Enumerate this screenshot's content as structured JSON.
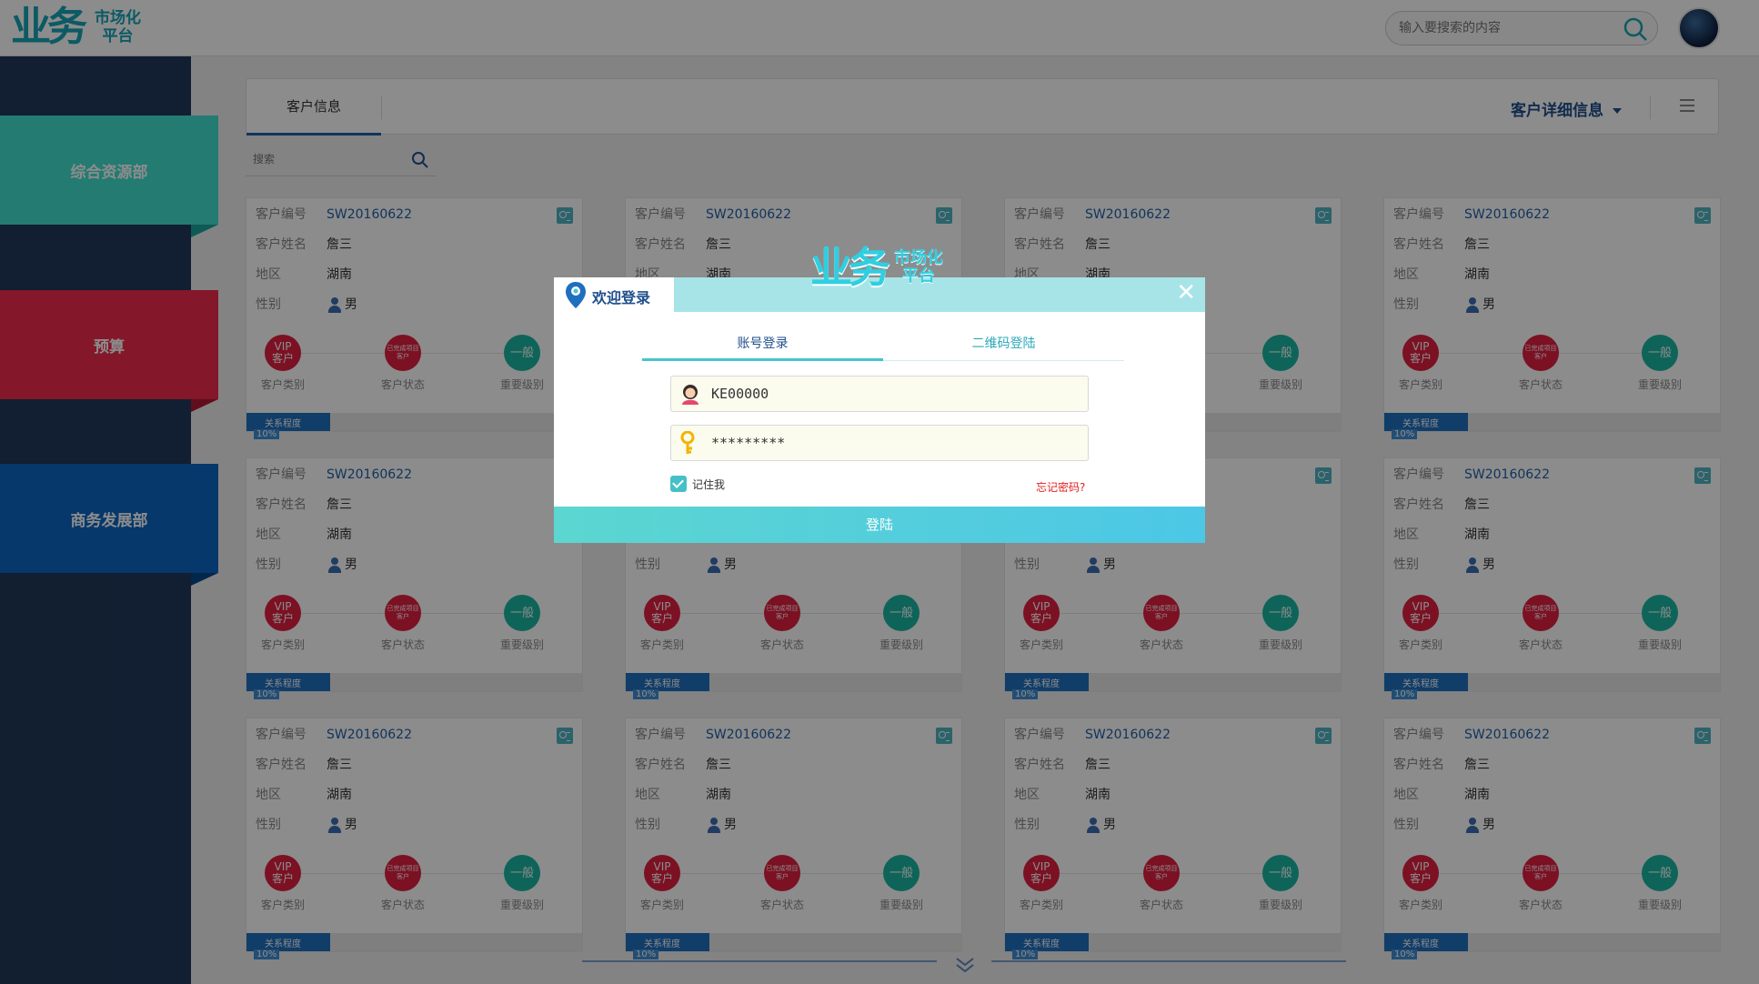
{
  "header": {
    "logo_main": "业务",
    "logo_sub1": "市场化",
    "logo_sub2": "平台",
    "search_placeholder": "输入要搜索的内容"
  },
  "sidebar": {
    "items": [
      {
        "label": "综合资源部",
        "color": "#40e0d0"
      },
      {
        "label": "预算",
        "color": "#f02a4d"
      },
      {
        "label": "商务发展部",
        "color": "#0c66c4"
      }
    ]
  },
  "panel": {
    "tab_label": "客户信息",
    "dropdown_label": "客户详细信息",
    "filter_placeholder": "搜索"
  },
  "card_labels": {
    "code": "客户编号",
    "name": "客户姓名",
    "region": "地区",
    "gender": "性别",
    "cat": "客户类别",
    "status": "客户状态",
    "level": "重要级别",
    "relation": "关系程度"
  },
  "cards": [
    {
      "code": "SW20160622",
      "name": "詹三",
      "region": "湖南",
      "gender": "男",
      "vip1": "VIP",
      "vip2": "客户",
      "status": "已完成项目客户",
      "level": "一般",
      "relation_percent": "10%"
    },
    {
      "code": "SW20160622",
      "name": "詹三",
      "region": "湖南",
      "gender": "男",
      "vip1": "VIP",
      "vip2": "客户",
      "status": "已完成项目客户",
      "level": "一般",
      "relation_percent": "10%"
    },
    {
      "code": "SW20160622",
      "name": "詹三",
      "region": "湖南",
      "gender": "男",
      "vip1": "VIP",
      "vip2": "客户",
      "status": "已完成项目客户",
      "level": "一般",
      "relation_percent": "10%"
    },
    {
      "code": "SW20160622",
      "name": "詹三",
      "region": "湖南",
      "gender": "男",
      "vip1": "VIP",
      "vip2": "客户",
      "status": "已完成项目客户",
      "level": "一般",
      "relation_percent": "10%"
    },
    {
      "code": "SW20160622",
      "name": "詹三",
      "region": "湖南",
      "gender": "男",
      "vip1": "VIP",
      "vip2": "客户",
      "status": "已完成项目客户",
      "level": "一般",
      "relation_percent": "10%"
    },
    {
      "code": "SW20160622",
      "name": "詹三",
      "region": "湖南",
      "gender": "男",
      "vip1": "VIP",
      "vip2": "客户",
      "status": "已完成项目客户",
      "level": "一般",
      "relation_percent": "10%"
    },
    {
      "code": "SW20160622",
      "name": "詹三",
      "region": "湖南",
      "gender": "男",
      "vip1": "VIP",
      "vip2": "客户",
      "status": "已完成项目客户",
      "level": "一般",
      "relation_percent": "10%"
    },
    {
      "code": "SW20160622",
      "name": "詹三",
      "region": "湖南",
      "gender": "男",
      "vip1": "VIP",
      "vip2": "客户",
      "status": "已完成项目客户",
      "level": "一般",
      "relation_percent": "10%"
    },
    {
      "code": "SW20160622",
      "name": "詹三",
      "region": "湖南",
      "gender": "男",
      "vip1": "VIP",
      "vip2": "客户",
      "status": "已完成项目客户",
      "level": "一般",
      "relation_percent": "10%"
    },
    {
      "code": "SW20160622",
      "name": "詹三",
      "region": "湖南",
      "gender": "男",
      "vip1": "VIP",
      "vip2": "客户",
      "status": "已完成项目客户",
      "level": "一般",
      "relation_percent": "10%"
    },
    {
      "code": "SW20160622",
      "name": "詹三",
      "region": "湖南",
      "gender": "男",
      "vip1": "VIP",
      "vip2": "客户",
      "status": "已完成项目客户",
      "level": "一般",
      "relation_percent": "10%"
    },
    {
      "code": "SW20160622",
      "name": "詹三",
      "region": "湖南",
      "gender": "男",
      "vip1": "VIP",
      "vip2": "客户",
      "status": "已完成项目客户",
      "level": "一般",
      "relation_percent": "10%"
    }
  ],
  "login": {
    "title": "欢迎登录",
    "logo_main": "业务",
    "logo_sub1": "市场化",
    "logo_sub2": "平台",
    "tab_account": "账号登录",
    "tab_qr": "二维码登陆",
    "username": "KE00000",
    "password": "*********",
    "remember_label": "记住我",
    "forgot_label": "忘记密码?",
    "submit_label": "登陆"
  },
  "icons": {
    "search": "search-icon",
    "menu": "menu-icon",
    "close": "close-icon",
    "user": "user-avatar-icon",
    "key": "key-icon",
    "pin": "location-pin-icon",
    "chevron": "double-chevron-down-icon"
  },
  "colors": {
    "brand": "#17a5b6",
    "sidebar_bg": "#21385a",
    "progress": "#1f6fbf"
  }
}
